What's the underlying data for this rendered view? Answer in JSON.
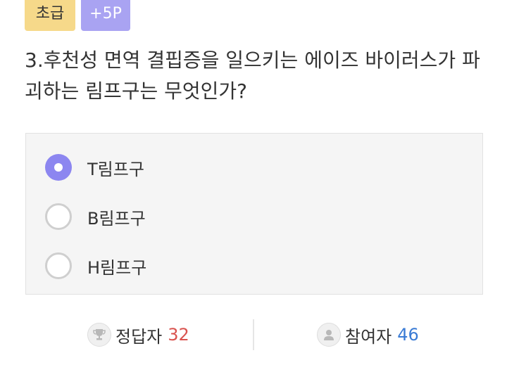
{
  "badges": {
    "level": "초급",
    "points": "+5P"
  },
  "question": {
    "text": "3.후천성 면역 결핍증을 일으키는 에이즈 바이러스가 파괴하는 림프구는 무엇인가?"
  },
  "options": [
    {
      "label": "T림프구",
      "selected": true
    },
    {
      "label": "B림프구",
      "selected": false
    },
    {
      "label": "H림프구",
      "selected": false
    }
  ],
  "stats": {
    "correct_label": "정답자",
    "correct_count": "32",
    "participants_label": "참여자",
    "participants_count": "46",
    "correct_icon": "trophy-icon",
    "participants_icon": "person-icon"
  },
  "colors": {
    "level_badge": "#f6d98a",
    "points_badge": "#a9a3f2",
    "radio_selected": "#8c86f0",
    "correct_count": "#d9534f",
    "participants_count": "#3a7bd5"
  }
}
